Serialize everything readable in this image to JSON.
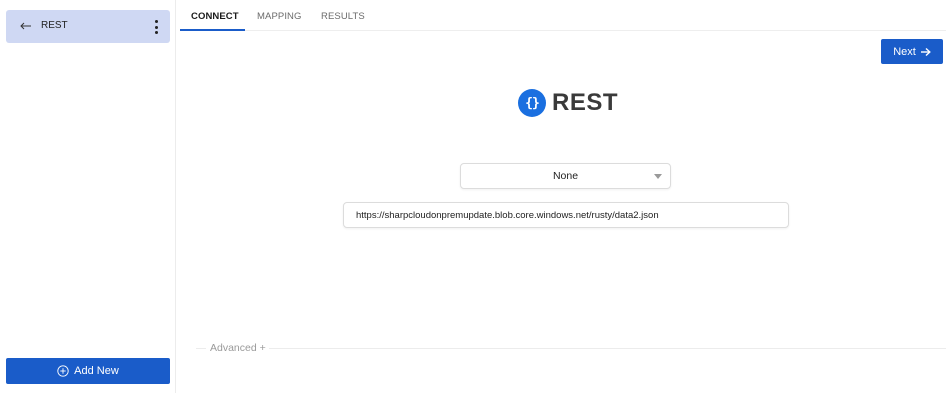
{
  "sidebar": {
    "items": [
      {
        "label": "REST",
        "icon": "back-arrow-icon"
      }
    ],
    "add_new_label": "Add New"
  },
  "tabs": [
    {
      "label": "CONNECT",
      "active": true
    },
    {
      "label": "MAPPING",
      "active": false
    },
    {
      "label": "RESULTS",
      "active": false
    }
  ],
  "toolbar": {
    "next_label": "Next"
  },
  "connector": {
    "name": "REST",
    "icon": "braces-icon"
  },
  "form": {
    "auth_selected": "None",
    "url_value": "https://sharpcloudonpremupdate.blob.core.windows.net/rusty/data2.json"
  },
  "advanced_label": "Advanced +",
  "colors": {
    "accent": "#1a5cc9",
    "selected_item_bg": "#cfd8f3",
    "logo_blue": "#1a6fe0"
  }
}
